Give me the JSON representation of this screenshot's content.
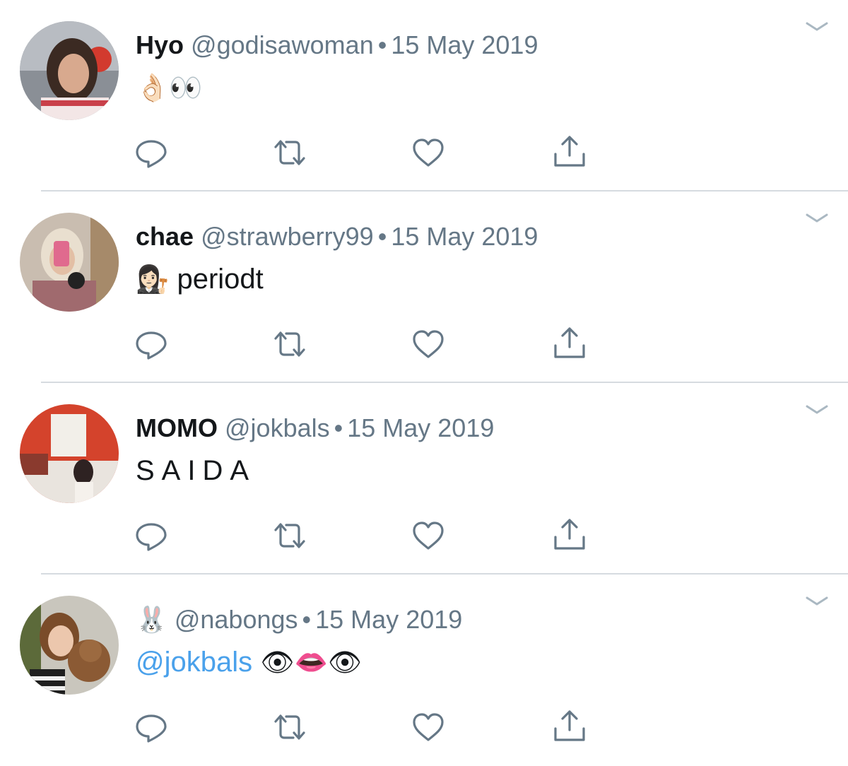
{
  "colors": {
    "text": "#14171a",
    "meta": "#657786",
    "mention": "#4aa1eb",
    "icon": "#657786",
    "divider": "#d6dbe0"
  },
  "tweets": [
    {
      "name": "Hyo",
      "handle": "@godisawoman",
      "separator": "•",
      "date": "15 May 2019",
      "emojis": "👌🏻👀",
      "text": ""
    },
    {
      "name": "chae",
      "handle": "@strawberry99",
      "separator": "•",
      "date": "15 May 2019",
      "emojis": "👩🏻‍⚖️",
      "text": "periodt"
    },
    {
      "name": "MOMO",
      "handle": "@jokbals",
      "separator": "•",
      "date": "15 May 2019",
      "emojis": "",
      "text": "SAIDA"
    },
    {
      "name": "🐰",
      "handle": "@nabongs",
      "separator": "•",
      "date": "15 May 2019",
      "mention": "@jokbals",
      "emojis": "👁👄👁",
      "text": ""
    }
  ],
  "icons": {
    "reply": "reply-icon",
    "retweet": "retweet-icon",
    "like": "heart-icon",
    "share": "share-icon",
    "menu": "chevron-down-icon"
  }
}
